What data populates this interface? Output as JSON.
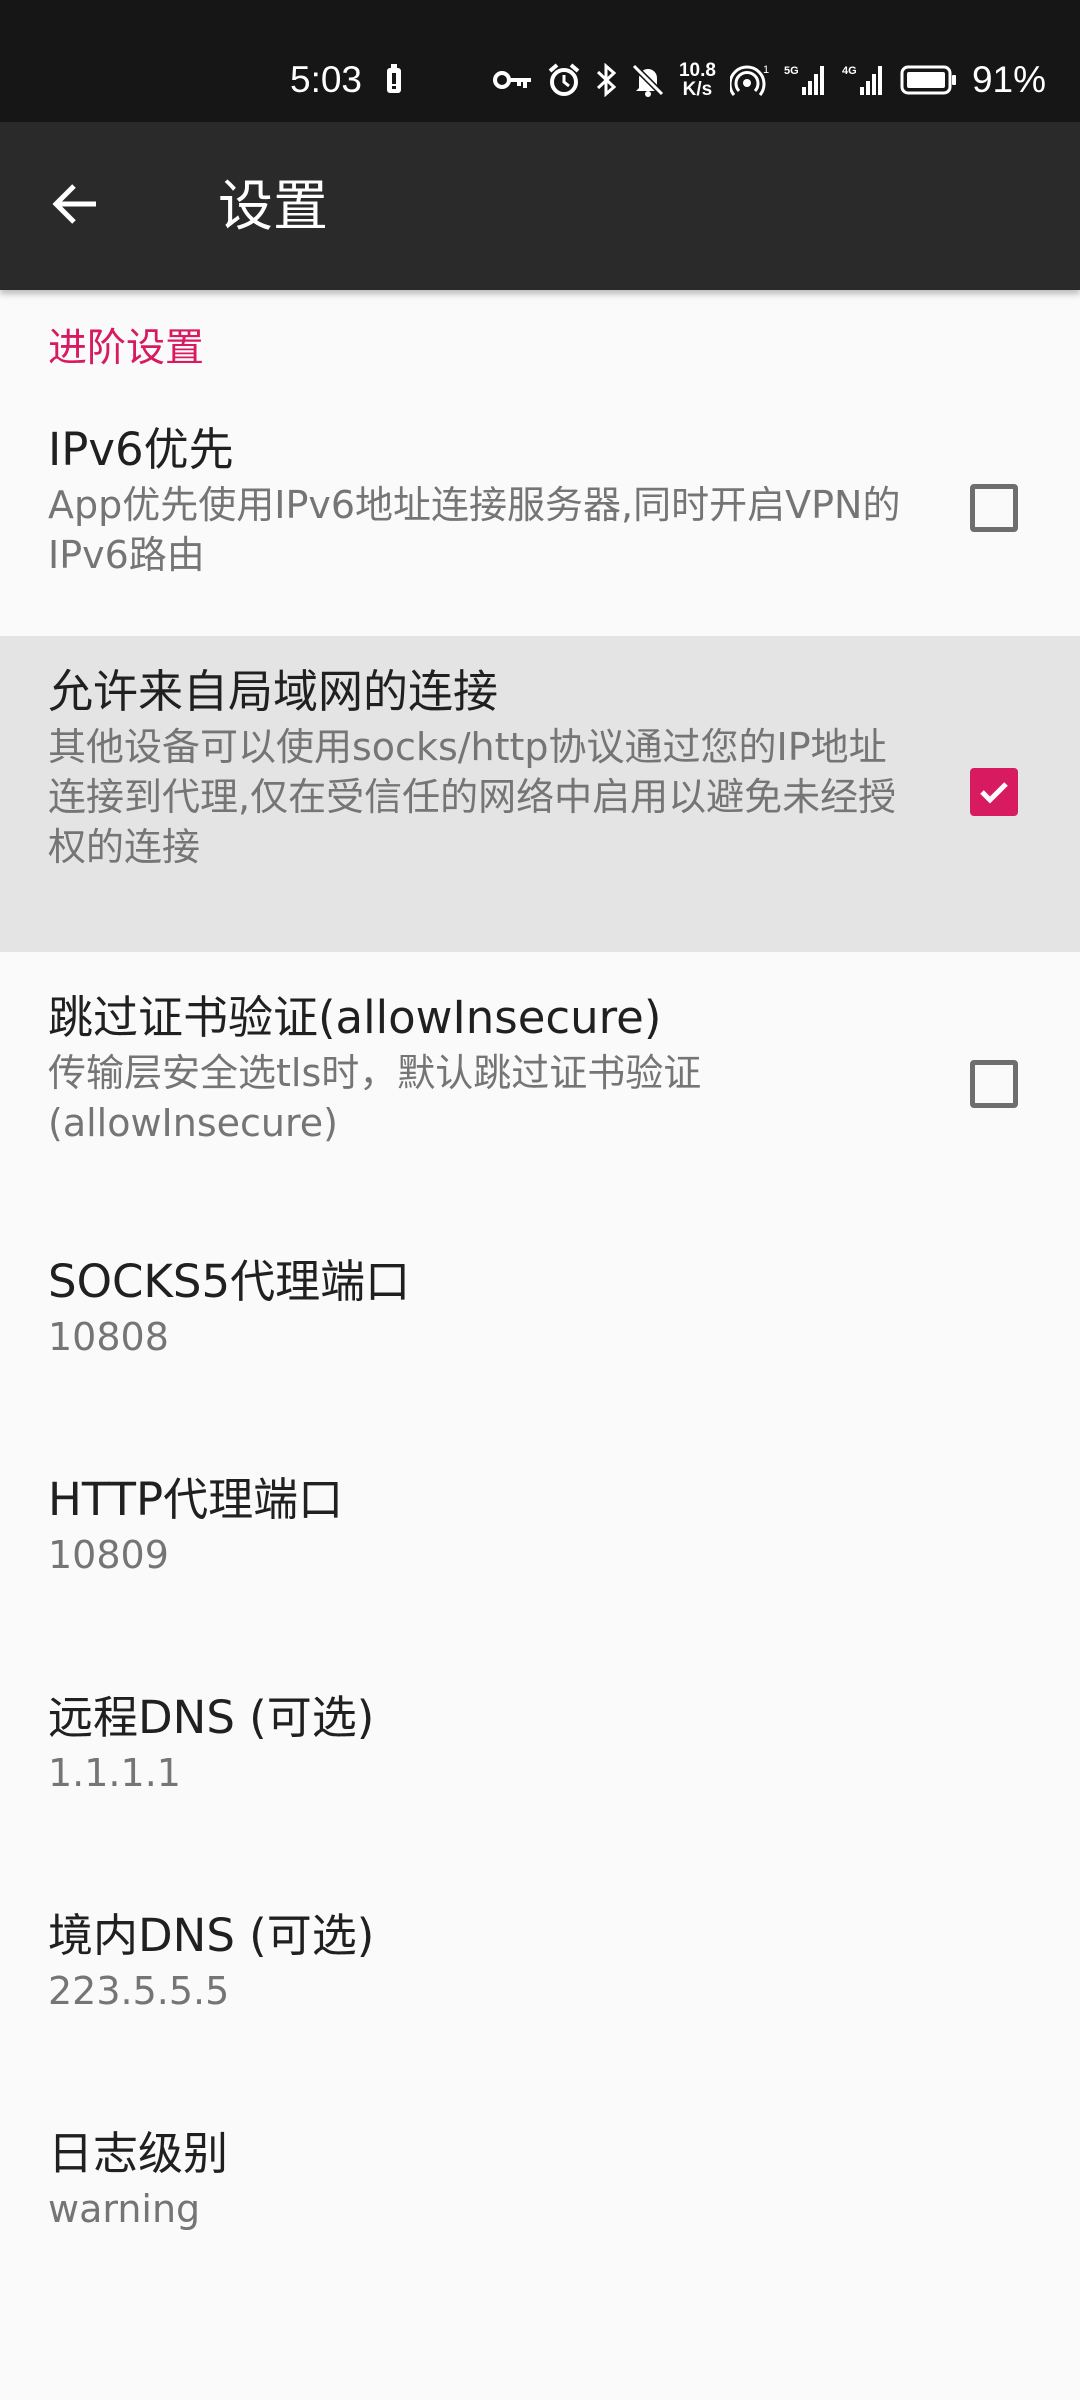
{
  "status_bar": {
    "time": "5:03",
    "net_speed_value": "10.8",
    "net_speed_unit": "K/s",
    "battery_percent": "91%",
    "icons": [
      "battery-saver-icon",
      "vpn-key-icon",
      "alarm-icon",
      "bluetooth-icon",
      "muted-bell-icon",
      "hotspot-icon",
      "signal-5g-icon",
      "signal-4g-icon",
      "battery-icon"
    ]
  },
  "app_bar": {
    "title": "设置",
    "back_icon": "arrow-back-icon"
  },
  "section": {
    "title": "进阶设置"
  },
  "preferences": {
    "ipv6": {
      "title": "IPv6优先",
      "summary": "App优先使用IPv6地址连接服务器,同时开启VPN的IPv6路由",
      "checked": false
    },
    "lan": {
      "title": "允许来自局域网的连接",
      "summary": "其他设备可以使用socks/http协议通过您的IP地址连接到代理,仅在受信任的网络中启用以避免未经授权的连接",
      "checked": true
    },
    "insecure": {
      "title": "跳过证书验证(allowInsecure)",
      "summary": "传输层安全选tls时，默认跳过证书验证(allowInsecure)",
      "checked": false
    },
    "socks_port": {
      "title": "SOCKS5代理端口",
      "value": "10808"
    },
    "http_port": {
      "title": "HTTP代理端口",
      "value": "10809"
    },
    "remote_dns": {
      "title": "远程DNS (可选)",
      "value": "1.1.1.1"
    },
    "domestic_dns": {
      "title": "境内DNS (可选)",
      "value": "223.5.5.5"
    },
    "log_level": {
      "title": "日志级别",
      "value": "warning"
    }
  },
  "colors": {
    "accent": "#d81b60",
    "app_bar": "#2a2a2a",
    "status_bar": "#161616",
    "background": "#fafafa",
    "checked_row": "#e4e4e4"
  }
}
